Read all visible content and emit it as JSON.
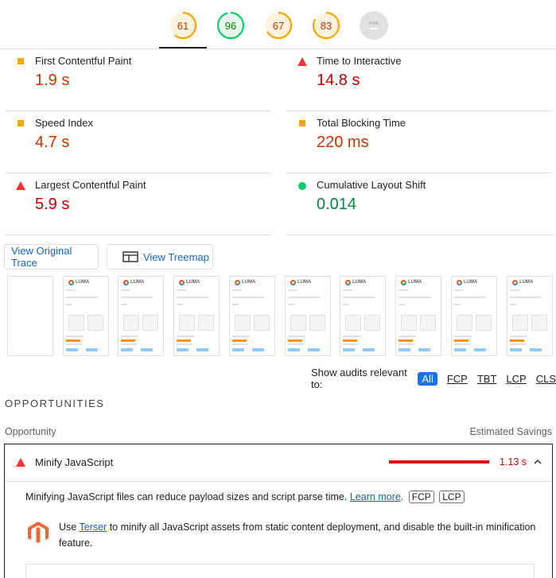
{
  "gauges": [
    {
      "name": "performance",
      "score": "61",
      "color": "#ffa400",
      "fraction": 0.61
    },
    {
      "name": "accessibility",
      "score": "96",
      "color": "#0cce6b",
      "fraction": 0.96
    },
    {
      "name": "best-practices",
      "score": "67",
      "color": "#ffa400",
      "fraction": 0.67
    },
    {
      "name": "seo",
      "score": "83",
      "color": "#ffa400",
      "fraction": 0.83
    }
  ],
  "pwa": {
    "label": "PWA"
  },
  "metrics": {
    "fcp": {
      "label": "First Contentful Paint",
      "value": "1.9 s",
      "color": "#c33300",
      "icon": "orange-square"
    },
    "tti": {
      "label": "Time to Interactive",
      "value": "14.8 s",
      "color": "#c00000",
      "icon": "red-triangle"
    },
    "si": {
      "label": "Speed Index",
      "value": "4.7 s",
      "color": "#c33300",
      "icon": "orange-square"
    },
    "tbt": {
      "label": "Total Blocking Time",
      "value": "220 ms",
      "color": "#c33300",
      "icon": "orange-square"
    },
    "lcp": {
      "label": "Largest Contentful Paint",
      "value": "5.9 s",
      "color": "#c00000",
      "icon": "red-triangle"
    },
    "cls": {
      "label": "Cumulative Layout Shift",
      "value": "0.014",
      "color": "#018642",
      "icon": "green-circle"
    }
  },
  "buttons": {
    "original_trace": "View Original Trace",
    "treemap": "View Treemap"
  },
  "filmstrip": {
    "brand": "LUMA",
    "frames": 10
  },
  "filters": {
    "label": "Show audits relevant to:",
    "chips": [
      "All",
      "FCP",
      "TBT",
      "LCP",
      "CLS"
    ],
    "active": "All"
  },
  "section": {
    "title": "OPPORTUNITIES"
  },
  "columns": {
    "opportunity": "Opportunity",
    "savings": "Estimated Savings"
  },
  "audit": {
    "title": "Minify JavaScript",
    "savings": "1.13 s",
    "description": "Minifying JavaScript files can reduce payload sizes and script parse time.",
    "learn_more": "Learn more",
    "tags": [
      "FCP",
      "LCP"
    ],
    "stack_text_pre": "Use",
    "stack_link": "Terser",
    "stack_text_post": "to minify all JavaScript assets from static content deployment, and disable the built-in minification feature."
  }
}
